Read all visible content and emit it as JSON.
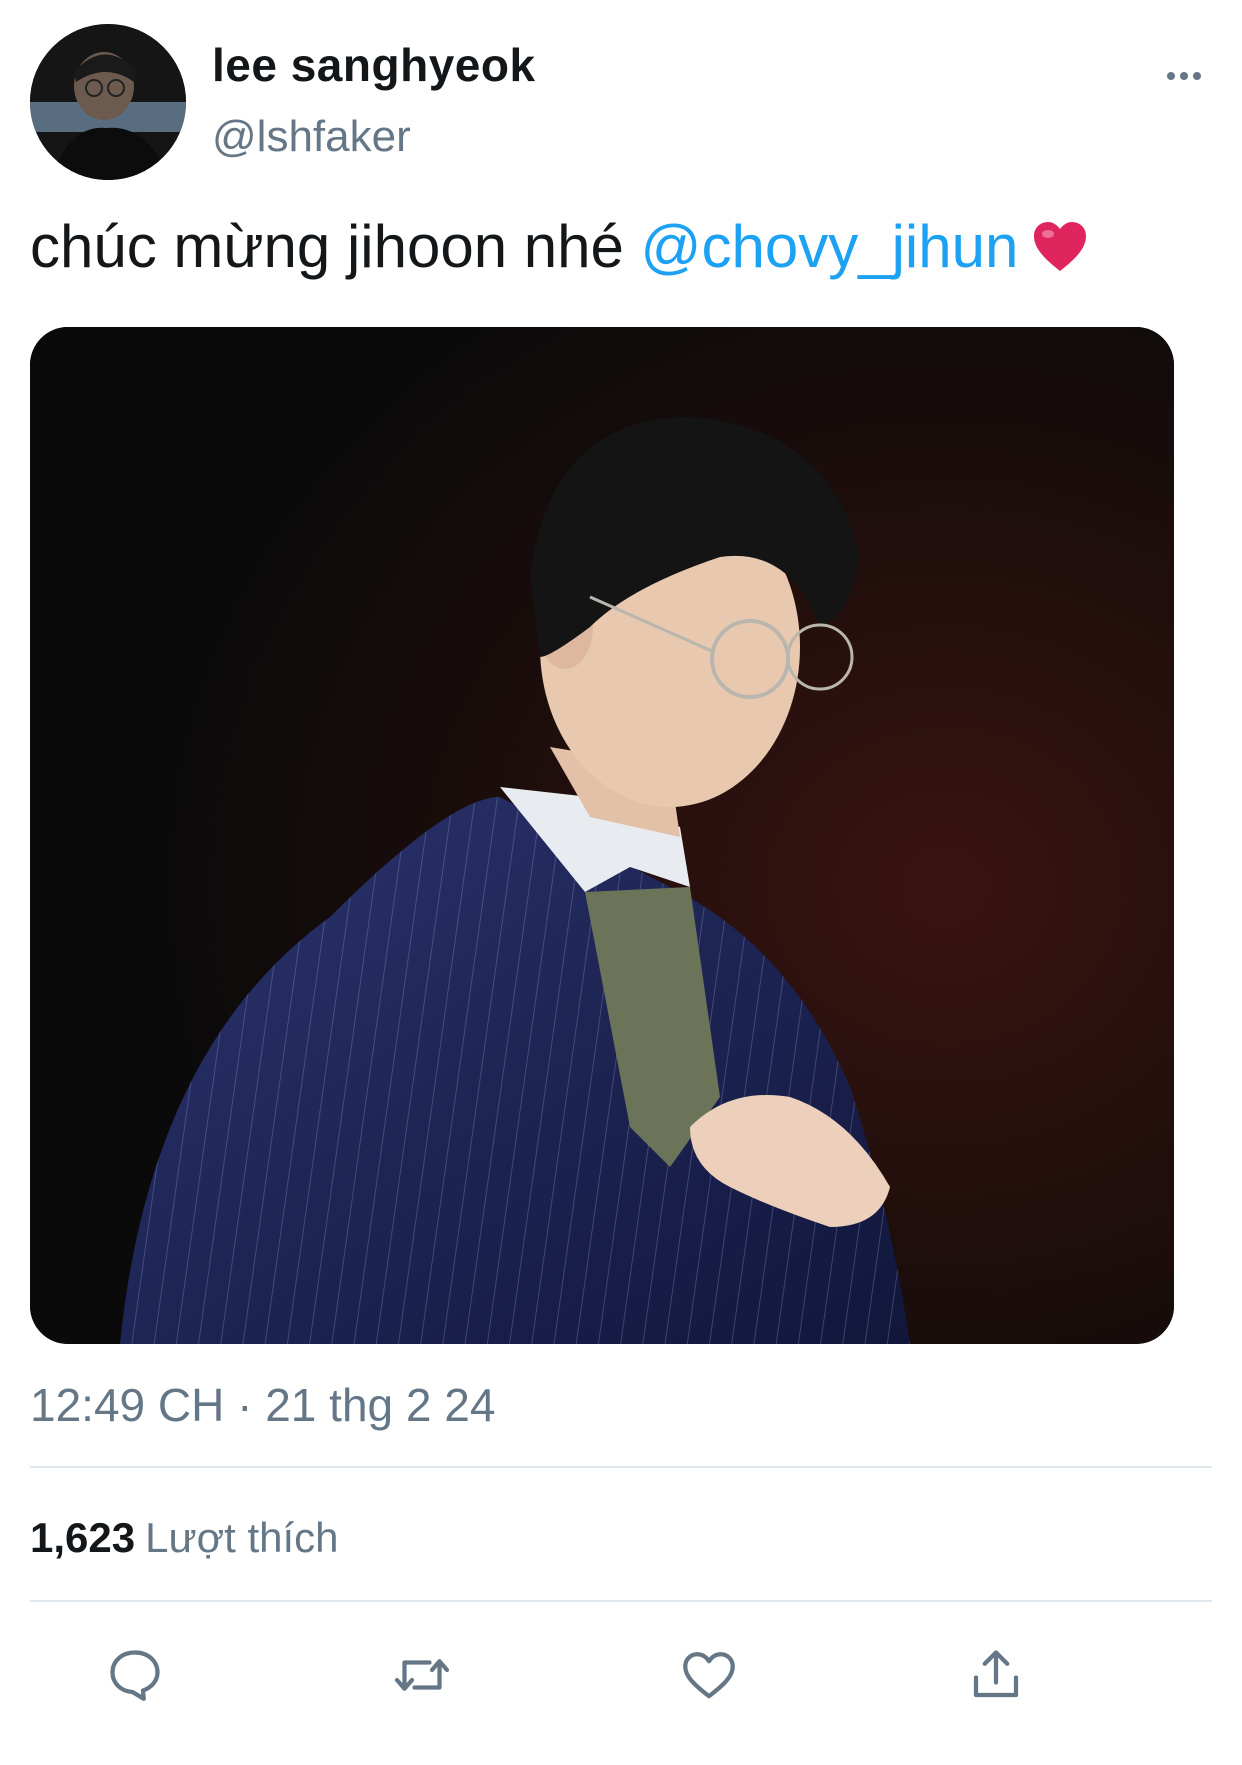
{
  "user": {
    "display_name": "lee sanghyeok",
    "handle": "@lshfaker"
  },
  "tweet": {
    "text": "chúc mừng jihoon nhé ",
    "mention": "@chovy_jihun",
    "emoji": "heart-emoji"
  },
  "meta": {
    "timestamp": "12:49 CH · 21 thg 2 24"
  },
  "stats": {
    "likes_count": "1,623",
    "likes_label": "Lượt thích"
  },
  "actions": [
    "reply-icon",
    "retweet-icon",
    "like-icon",
    "share-icon"
  ],
  "colors": {
    "accent": "#1da1f2",
    "muted": "#657786",
    "text": "#14171a",
    "divider": "#e1e8ed",
    "heart": "#e0245e"
  }
}
